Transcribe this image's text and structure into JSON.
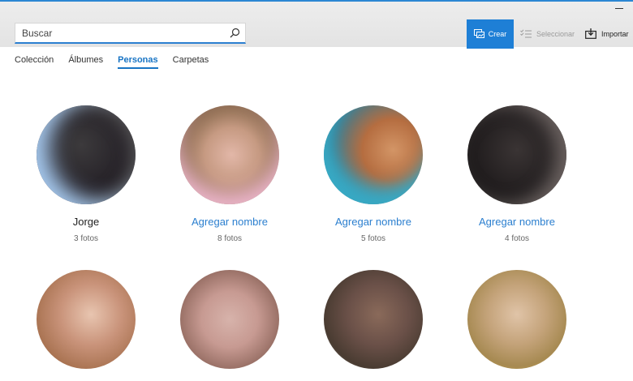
{
  "search": {
    "placeholder": "Buscar"
  },
  "toolbar": {
    "crear_label": "Crear",
    "seleccionar_label": "Seleccionar",
    "importar_label": "Importar"
  },
  "tabs": [
    {
      "label": "Colección"
    },
    {
      "label": "Álbumes"
    },
    {
      "label": "Personas",
      "active": true
    },
    {
      "label": "Carpetas"
    }
  ],
  "people": [
    {
      "name": "Jorge",
      "count": "3 fotos"
    },
    {
      "name": "Agregar nombre",
      "count": "8 fotos"
    },
    {
      "name": "Agregar nombre",
      "count": "5 fotos"
    },
    {
      "name": "Agregar nombre",
      "count": "4 fotos"
    },
    {
      "name": "",
      "count": ""
    },
    {
      "name": "",
      "count": ""
    },
    {
      "name": "",
      "count": ""
    },
    {
      "name": "",
      "count": ""
    }
  ],
  "colors": {
    "accent": "#1e7fd6",
    "link": "#2b7fcf"
  }
}
